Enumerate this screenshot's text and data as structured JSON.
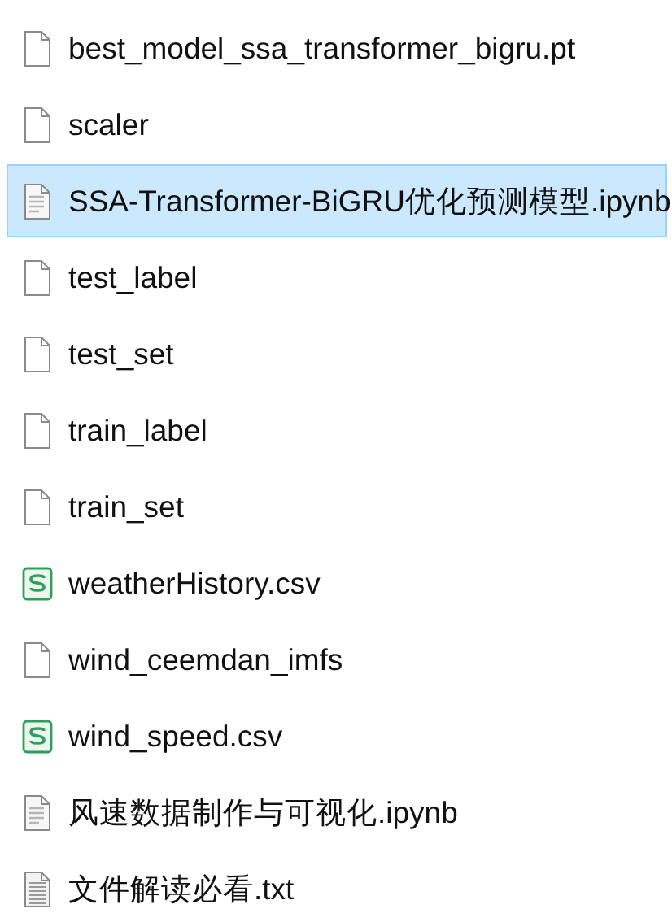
{
  "files": [
    {
      "name": "best_model_ssa_transformer_bigru.pt",
      "kind": "blank",
      "selected": false
    },
    {
      "name": "scaler",
      "kind": "blank",
      "selected": false
    },
    {
      "name": "SSA-Transformer-BiGRU优化预测模型.ipynb",
      "kind": "text",
      "selected": true
    },
    {
      "name": "test_label",
      "kind": "blank",
      "selected": false
    },
    {
      "name": "test_set",
      "kind": "blank",
      "selected": false
    },
    {
      "name": "train_label",
      "kind": "blank",
      "selected": false
    },
    {
      "name": "train_set",
      "kind": "blank",
      "selected": false
    },
    {
      "name": "weatherHistory.csv",
      "kind": "sheet",
      "selected": false
    },
    {
      "name": "wind_ceemdan_imfs",
      "kind": "blank",
      "selected": false
    },
    {
      "name": "wind_speed.csv",
      "kind": "sheet",
      "selected": false
    },
    {
      "name": "风速数据制作与可视化.ipynb",
      "kind": "text",
      "selected": false
    },
    {
      "name": "文件解读必看.txt",
      "kind": "note",
      "selected": false
    }
  ]
}
